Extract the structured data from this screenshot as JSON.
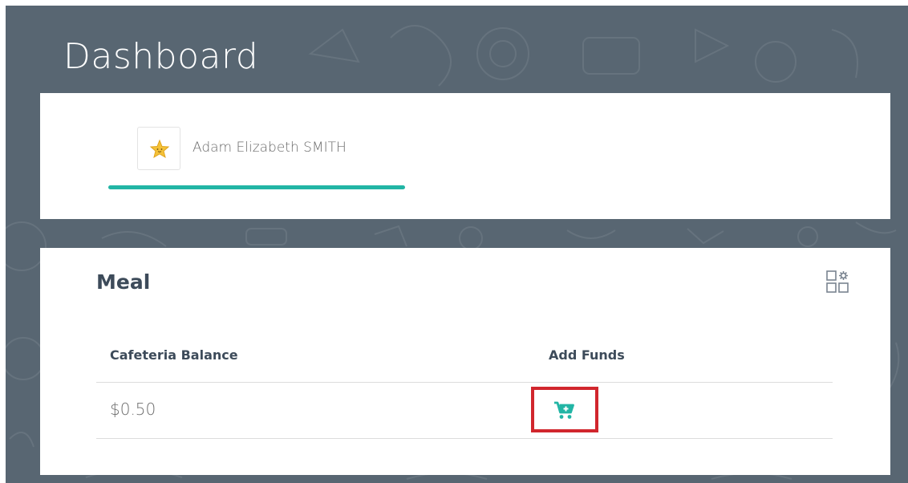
{
  "page": {
    "title": "Dashboard"
  },
  "student": {
    "name": "Adam Elizabeth SMITH",
    "avatar_icon": "star-icon"
  },
  "meal": {
    "title": "Meal",
    "settings_icon": "widget-settings-icon",
    "columns": [
      "Cafeteria Balance",
      "Add Funds"
    ],
    "rows": [
      {
        "balance": "$0.50",
        "action_icon": "cart-plus-icon"
      }
    ]
  },
  "colors": {
    "background": "#586672",
    "accent": "#22b5a5",
    "heading": "#3d4b5a",
    "highlight": "#d1262d"
  }
}
